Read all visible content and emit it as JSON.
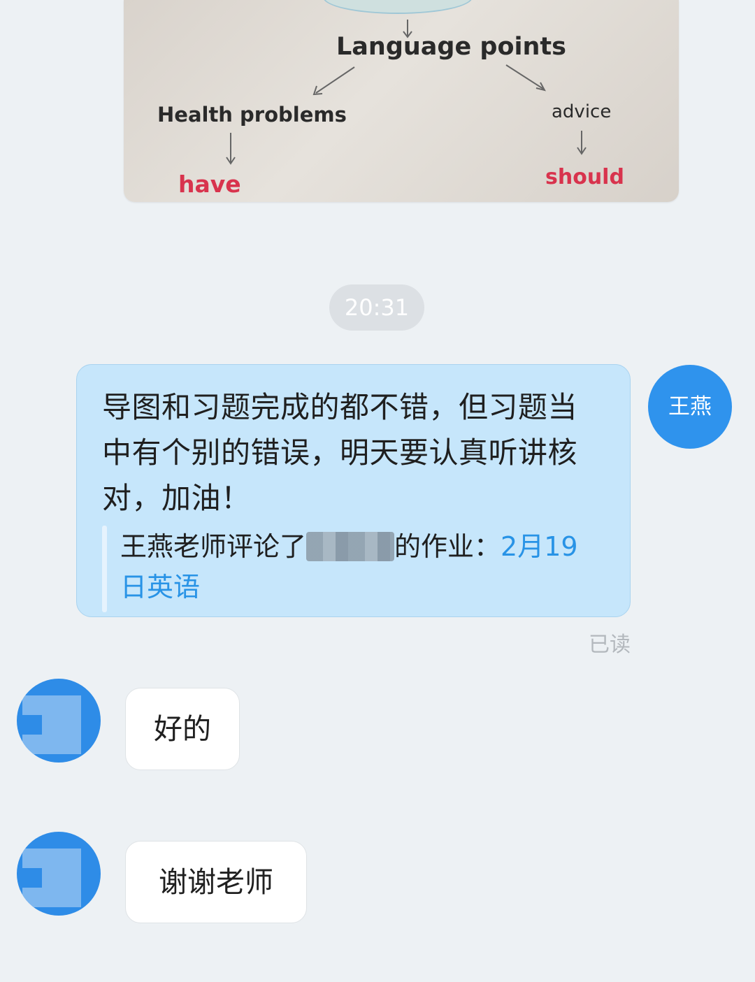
{
  "chat": {
    "image": {
      "language_points": "Language points",
      "health_problems": "Health problems",
      "advice": "advice",
      "have": "have",
      "should": "should"
    },
    "time": "20:31",
    "sent_message": {
      "text": "导图和习题完成的都不错，但习题当中有个别的错误，明天要认真听讲核对，加油！",
      "quote_prefix": "王燕老师评论了",
      "quote_middle": "的作业：",
      "quote_link": "2月19日英语",
      "status": "已读"
    },
    "sender": {
      "avatar_text": "王燕"
    },
    "received_messages": [
      {
        "text": "好的"
      },
      {
        "text": "谢谢老师"
      }
    ]
  }
}
